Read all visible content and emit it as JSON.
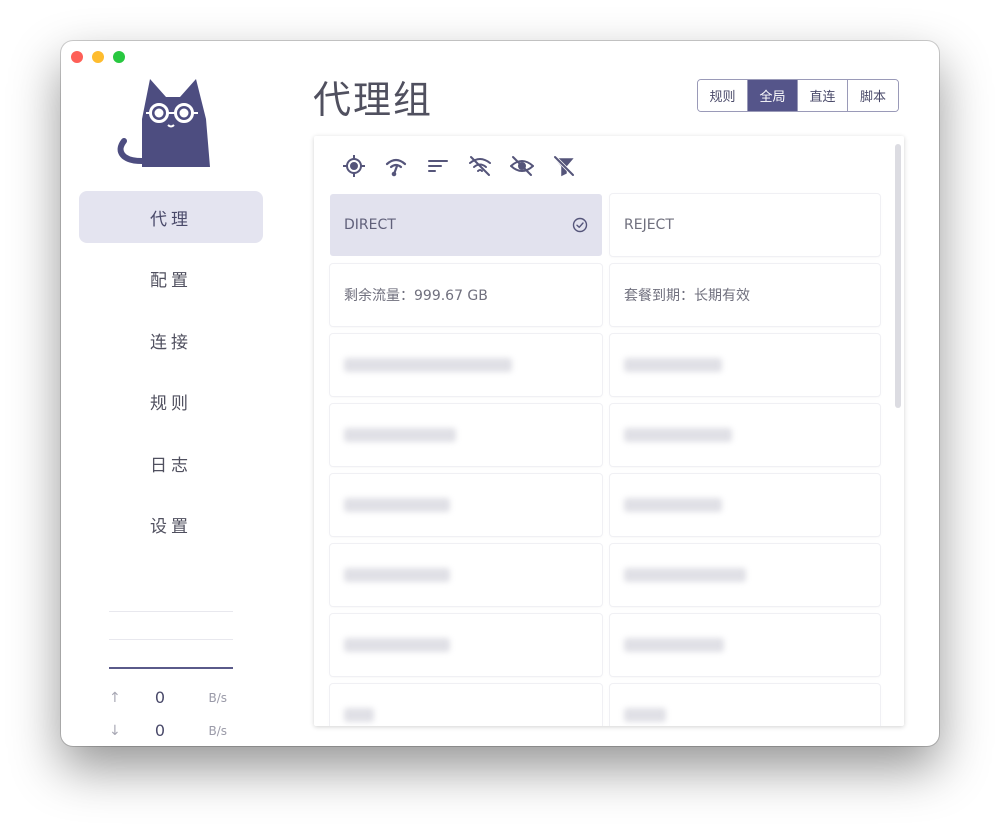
{
  "colors": {
    "accent": "#55558a",
    "close": "#fe5f57",
    "minimize": "#febc2e",
    "zoom": "#28c840"
  },
  "sidebar": {
    "items": [
      {
        "label": "代理",
        "active": true
      },
      {
        "label": "配置",
        "active": false
      },
      {
        "label": "连接",
        "active": false
      },
      {
        "label": "规则",
        "active": false
      },
      {
        "label": "日志",
        "active": false
      },
      {
        "label": "设置",
        "active": false
      }
    ],
    "traffic": {
      "up": {
        "icon": "arrow-up-icon",
        "value": "0",
        "unit": "B/s"
      },
      "down": {
        "icon": "arrow-down-icon",
        "value": "0",
        "unit": "B/s"
      }
    }
  },
  "header": {
    "title": "代理组",
    "modes": [
      {
        "label": "规则",
        "active": false
      },
      {
        "label": "全局",
        "active": true
      },
      {
        "label": "直连",
        "active": false
      },
      {
        "label": "脚本",
        "active": false
      }
    ]
  },
  "toolbar": {
    "icons": [
      "locate-icon",
      "latency-test-icon",
      "sort-icon",
      "hide-unavailable-icon",
      "hide-eye-icon",
      "filter-off-icon"
    ]
  },
  "proxies": {
    "direct": {
      "label": "DIRECT",
      "selected": true
    },
    "reject": {
      "label": "REJECT"
    },
    "traffic_info": "剩余流量：999.67 GB",
    "expiry_info": "套餐到期：长期有效"
  }
}
